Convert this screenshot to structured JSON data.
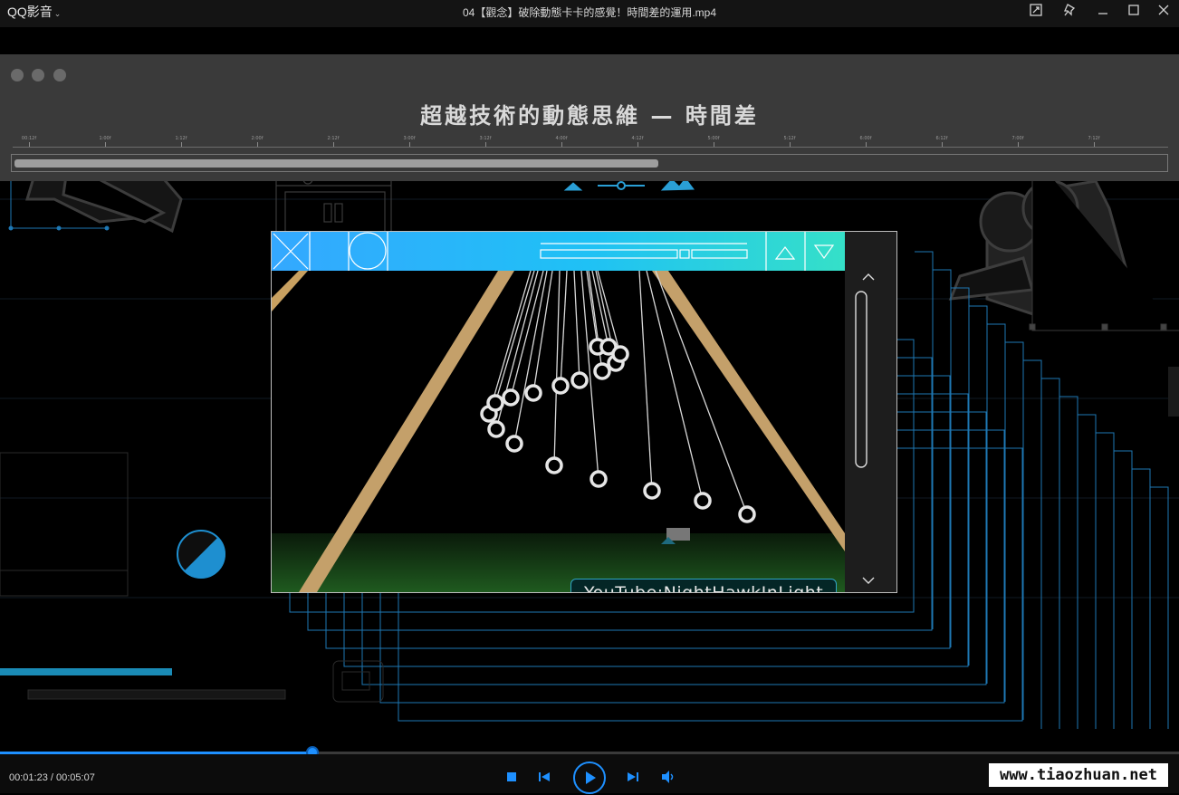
{
  "titlebar": {
    "app_name": "QQ影音",
    "file_title": "04【觀念】破除動態卡卡的感覺！時間差的運用.mp4",
    "buttons": [
      "clip-icon",
      "pin-icon",
      "minimize-icon",
      "maximize-icon",
      "close-icon"
    ]
  },
  "slide": {
    "title": "超越技術的動態思維 — 時間差",
    "ruler_labels": [
      "00:12f",
      "1:00f",
      "1:12f",
      "2:00f",
      "2:12f",
      "3:00f",
      "3:12f",
      "4:00f",
      "4:12f",
      "5:00f",
      "5:12f",
      "6:00f",
      "6:12f",
      "7:00f",
      "7:12f"
    ],
    "scrollbar_fill_fraction": 0.56,
    "credit": "YouTube:NightHawkInLight"
  },
  "player": {
    "current_time": "00:01:23",
    "total_time": "00:05:07",
    "time_separator": " / ",
    "progress_fraction": 0.265,
    "accent_color": "#1e90ff"
  },
  "watermark": "www.tiaozhuan.net"
}
